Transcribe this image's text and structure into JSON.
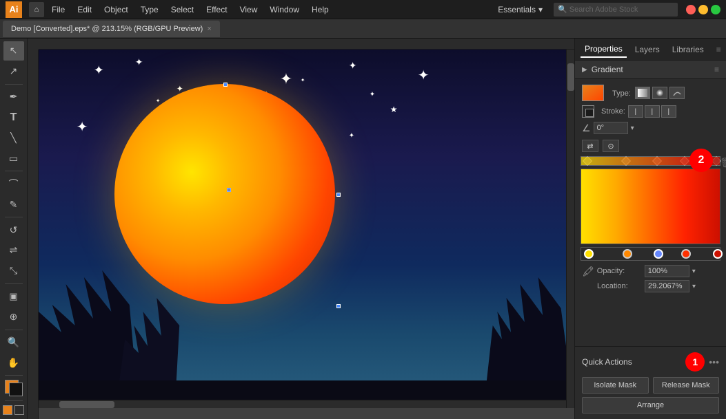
{
  "app": {
    "logo": "Ai",
    "menu_items": [
      "File",
      "Edit",
      "Object",
      "Type",
      "Select",
      "Effect",
      "View",
      "Window",
      "Help"
    ],
    "workspace": "Essentials",
    "window_controls": [
      "close",
      "minimize",
      "maximize"
    ]
  },
  "tab": {
    "title": "Demo [Converted].eps* @ 213.15% (RGB/GPU Preview)",
    "close": "×"
  },
  "panel_tabs": {
    "tabs": [
      "Properties",
      "Layers",
      "Libraries"
    ],
    "active": "Properties"
  },
  "gradient_panel": {
    "title": "Gradient",
    "type_label": "Type:",
    "stroke_label": "Stroke:",
    "angle_label": "0°",
    "type_buttons": [
      "linear",
      "radial",
      "freeform"
    ],
    "stroke_buttons": [
      "s1",
      "s2",
      "s3"
    ]
  },
  "opacity_row": {
    "label": "Opacity:",
    "value": "100%"
  },
  "location_row": {
    "label": "Location:",
    "value": "29.2067%"
  },
  "quick_actions": {
    "title": "Quick Actions",
    "buttons": [
      [
        "Isolate Mask",
        "Release Mask"
      ],
      [
        "Arrange"
      ]
    ]
  },
  "gradient_stops": [
    {
      "left": "2%",
      "color": "#ffe000"
    },
    {
      "left": "30%",
      "color": "#ffaa00"
    },
    {
      "left": "52%",
      "color": "#ff6a00"
    },
    {
      "left": "72%",
      "color": "#ff3000"
    },
    {
      "left": "97%",
      "color": "#cc1000"
    }
  ],
  "bottom_stops": [
    {
      "left": "2%",
      "color": "#ffe000"
    },
    {
      "left": "30%",
      "color": "#ff8800"
    },
    {
      "left": "52%",
      "color": "#6688ff"
    },
    {
      "left": "72%",
      "color": "#ff3000"
    },
    {
      "left": "97%",
      "color": "#cc1000"
    }
  ],
  "tools": [
    {
      "name": "select",
      "icon": "↖"
    },
    {
      "name": "direct-select",
      "icon": "↗"
    },
    {
      "name": "pen",
      "icon": "✒"
    },
    {
      "name": "type",
      "icon": "T"
    },
    {
      "name": "line",
      "icon": "╲"
    },
    {
      "name": "rectangle",
      "icon": "▭"
    },
    {
      "name": "paintbrush",
      "icon": "⌒"
    },
    {
      "name": "pencil",
      "icon": "✎"
    },
    {
      "name": "rotate",
      "icon": "↺"
    },
    {
      "name": "mirror",
      "icon": "⇌"
    },
    {
      "name": "scale",
      "icon": "⤡"
    },
    {
      "name": "warp",
      "icon": "~"
    },
    {
      "name": "gradient",
      "icon": "▣"
    },
    {
      "name": "mesh",
      "icon": "⊞"
    },
    {
      "name": "shape-builder",
      "icon": "⊕"
    },
    {
      "name": "scissors",
      "icon": "✂"
    },
    {
      "name": "zoom",
      "icon": "🔍"
    },
    {
      "name": "hand",
      "icon": "✋"
    }
  ],
  "annotation_1": "1",
  "annotation_2": "2"
}
